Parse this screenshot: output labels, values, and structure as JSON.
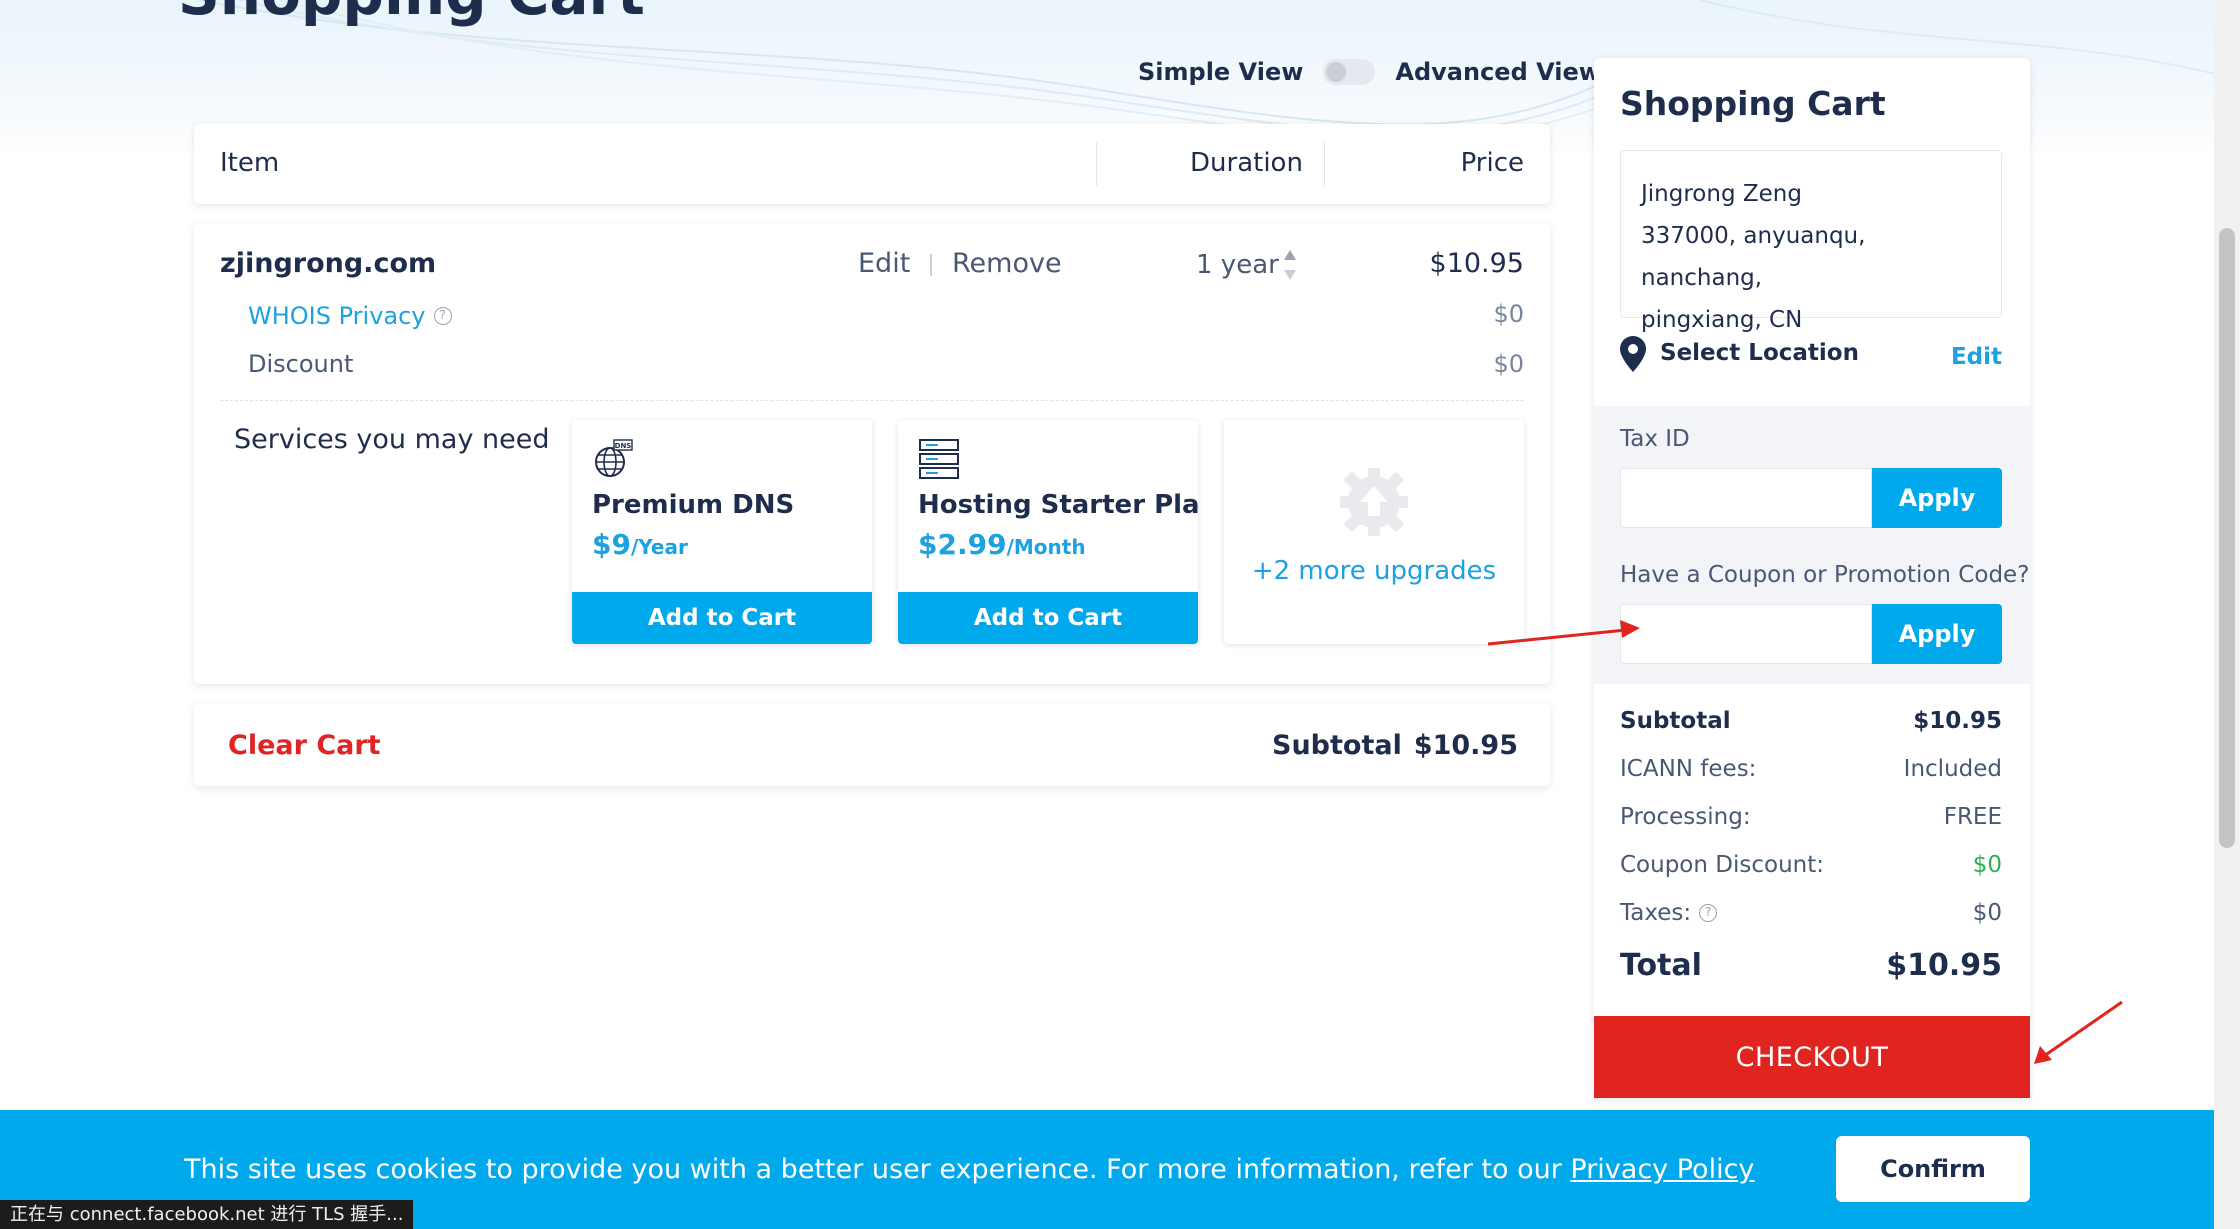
{
  "page": {
    "title": "Shopping Cart"
  },
  "view_toggle": {
    "simple_label": "Simple View",
    "advanced_label": "Advanced View"
  },
  "table_header": {
    "item": "Item",
    "duration": "Duration",
    "price": "Price"
  },
  "cart_item": {
    "domain": "zjingrong.com",
    "edit_label": "Edit",
    "remove_label": "Remove",
    "duration": "1 year",
    "price": "$10.95",
    "whois_label": "WHOIS Privacy",
    "whois_price": "$0",
    "discount_label": "Discount",
    "discount_price": "$0"
  },
  "services": {
    "label": "Services you may need",
    "items": [
      {
        "name": "Premium DNS",
        "amount": "$9",
        "period": "/Year",
        "button": "Add to Cart",
        "icon": "dns-globe-icon"
      },
      {
        "name": "Hosting Starter Plan",
        "amount": "$2.99",
        "period": "/Month",
        "button": "Add to Cart",
        "icon": "server-icon"
      }
    ],
    "more_label": "+2 more upgrades"
  },
  "subtotal_bar": {
    "clear_cart": "Clear Cart",
    "subtotal_label": "Subtotal",
    "subtotal_value": "$10.95"
  },
  "side_panel": {
    "title": "Shopping Cart",
    "address": {
      "name": "Jingrong Zeng",
      "line1": "337000, anyuanqu, nanchang,",
      "line2": "pingxiang, CN"
    },
    "location_label": "Select Location",
    "location_edit": "Edit",
    "tax_id_label": "Tax ID",
    "tax_id_value": "",
    "tax_apply": "Apply",
    "coupon_label": "Have a Coupon or Promotion Code?",
    "coupon_value": "",
    "coupon_apply": "Apply",
    "summary": {
      "subtotal_label": "Subtotal",
      "subtotal_value": "$10.95",
      "icann_label": "ICANN fees:",
      "icann_value": "Included",
      "processing_label": "Processing:",
      "processing_value": "FREE",
      "coupon_discount_label": "Coupon Discount:",
      "coupon_discount_value": "$0",
      "taxes_label": "Taxes:",
      "taxes_value": "$0",
      "total_label": "Total",
      "total_value": "$10.95"
    },
    "checkout": "CHECKOUT"
  },
  "cookie_banner": {
    "text": "This site uses cookies to provide you with a better user experience. For more information, refer to our ",
    "link": "Privacy Policy",
    "confirm": "Confirm"
  },
  "status_bar": {
    "text": "正在与 connect.facebook.net 进行 TLS 握手..."
  },
  "colors": {
    "accent": "#00a8ec",
    "link": "#1da1e0",
    "danger": "#e0241f",
    "text": "#1f2d4d",
    "success": "#2bb24c"
  }
}
